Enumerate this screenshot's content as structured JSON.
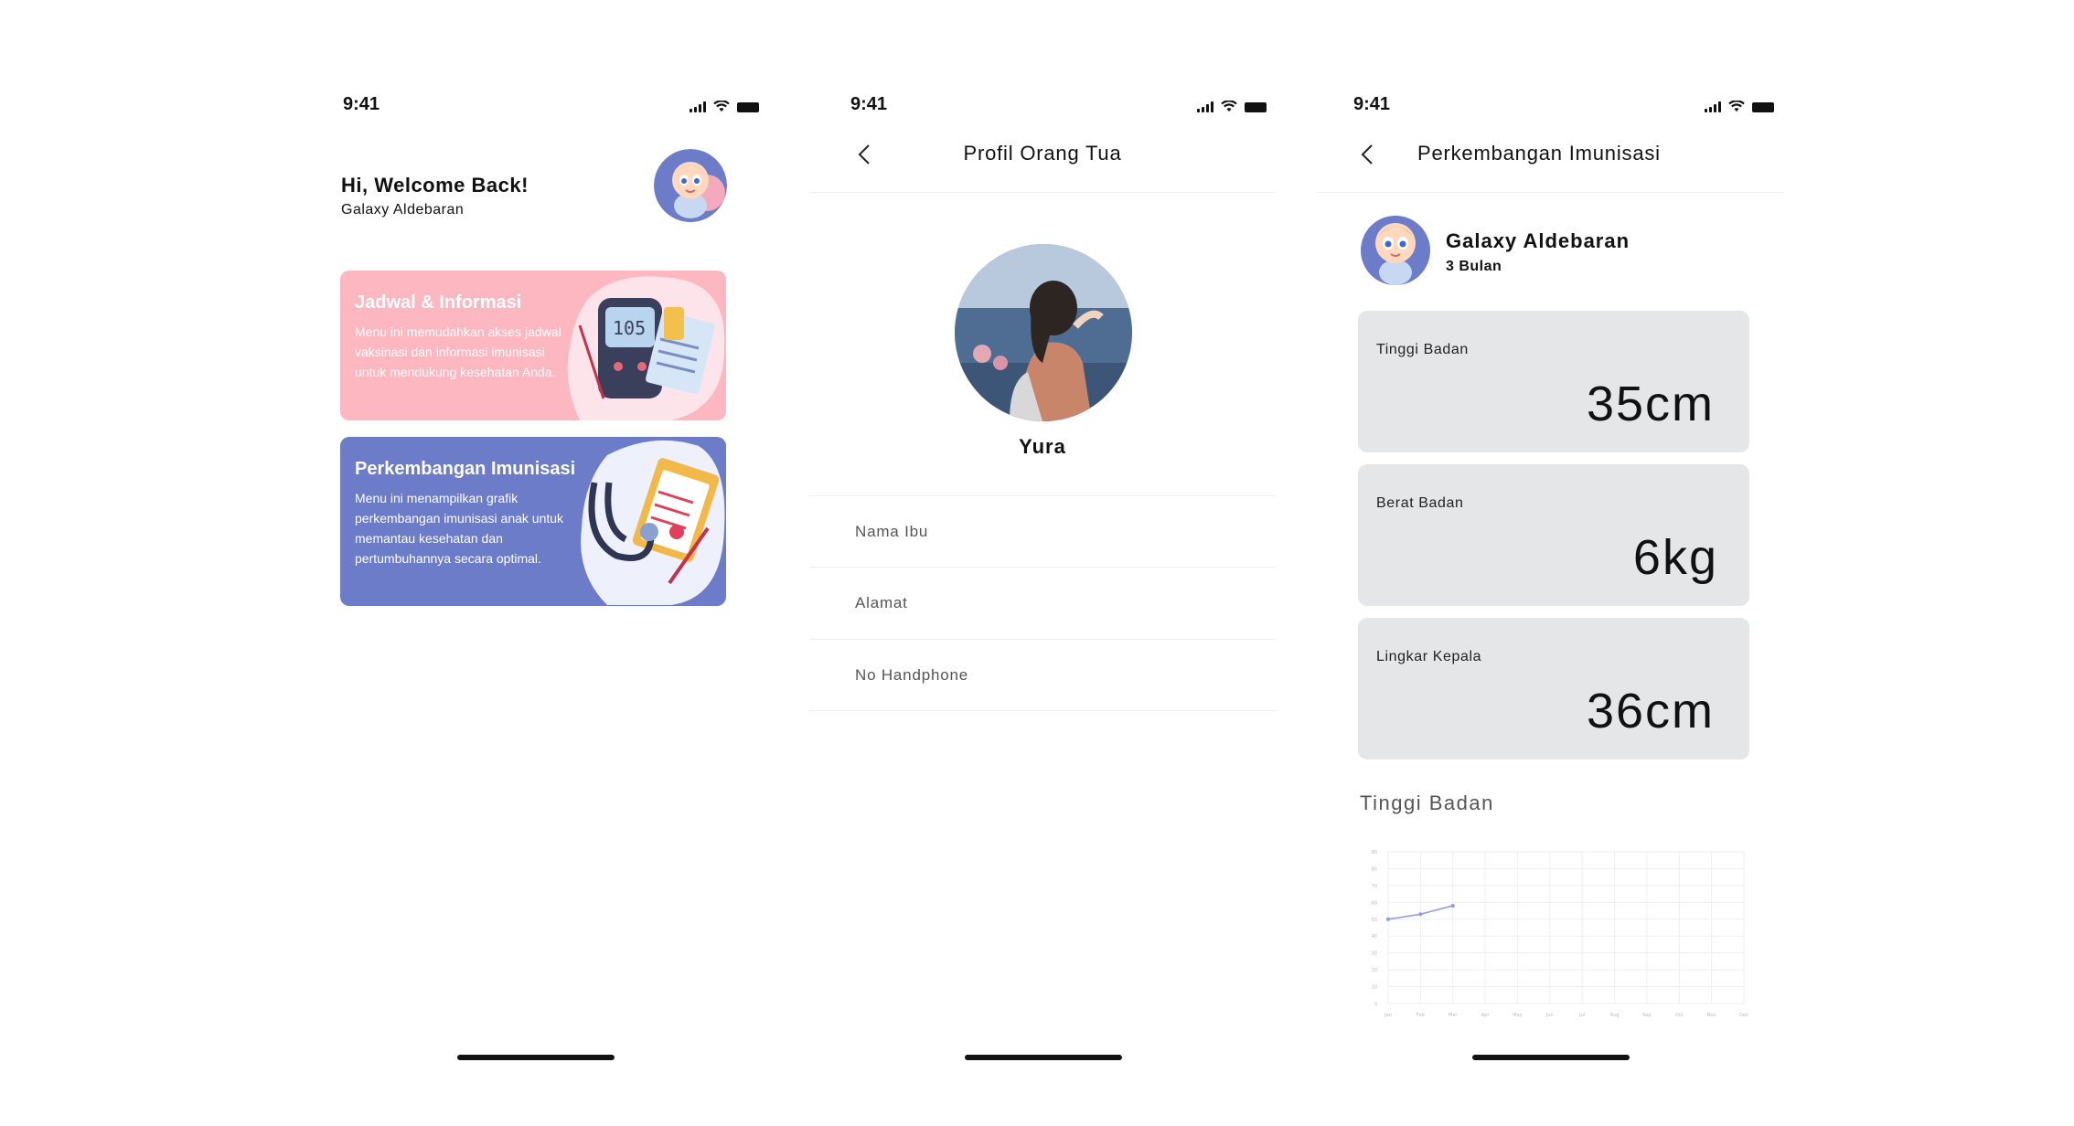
{
  "status": {
    "time": "9:41"
  },
  "home": {
    "greeting": "Hi, Welcome Back!",
    "username": "Galaxy Aldebaran",
    "cards": [
      {
        "title": "Jadwal & Informasi",
        "desc": "Menu ini memudahkan akses jadwal vaksinasi dan informasi imunisasi untuk mendukung kesehatan Anda.",
        "color": "#fdb7c1"
      },
      {
        "title": "Perkembangan Imunisasi",
        "desc": "Menu ini menampilkan grafik perkembangan imunisasi anak untuk memantau kesehatan dan pertumbuhannya secara optimal.",
        "color": "#6c7cc8"
      }
    ]
  },
  "profile": {
    "title": "Profil Orang Tua",
    "name": "Yura",
    "fields": [
      "Nama Ibu",
      "Alamat",
      "No Handphone"
    ]
  },
  "growth": {
    "title": "Perkembangan Imunisasi",
    "child_name": "Galaxy Aldebaran",
    "child_age": "3 Bulan",
    "metrics": [
      {
        "label": "Tinggi Badan",
        "value": "35cm"
      },
      {
        "label": "Berat Badan",
        "value": "6kg"
      },
      {
        "label": "Lingkar Kepala",
        "value": "36cm"
      }
    ],
    "chart_title": "Tinggi Badan"
  },
  "chart_data": {
    "type": "line",
    "categories": [
      "Jan",
      "Feb",
      "Mar",
      "Apr",
      "May",
      "Jun",
      "Jul",
      "Aug",
      "Sep",
      "Oct",
      "Nov",
      "Dec"
    ],
    "y_ticks": [
      "90",
      "80",
      "70",
      "60",
      "50",
      "40",
      "30",
      "20",
      "10",
      "0"
    ],
    "series": [
      {
        "values": [
          50,
          53,
          58
        ]
      }
    ],
    "ylim": [
      0,
      90
    ],
    "grid": true,
    "line_color": "#8c9ae8"
  }
}
